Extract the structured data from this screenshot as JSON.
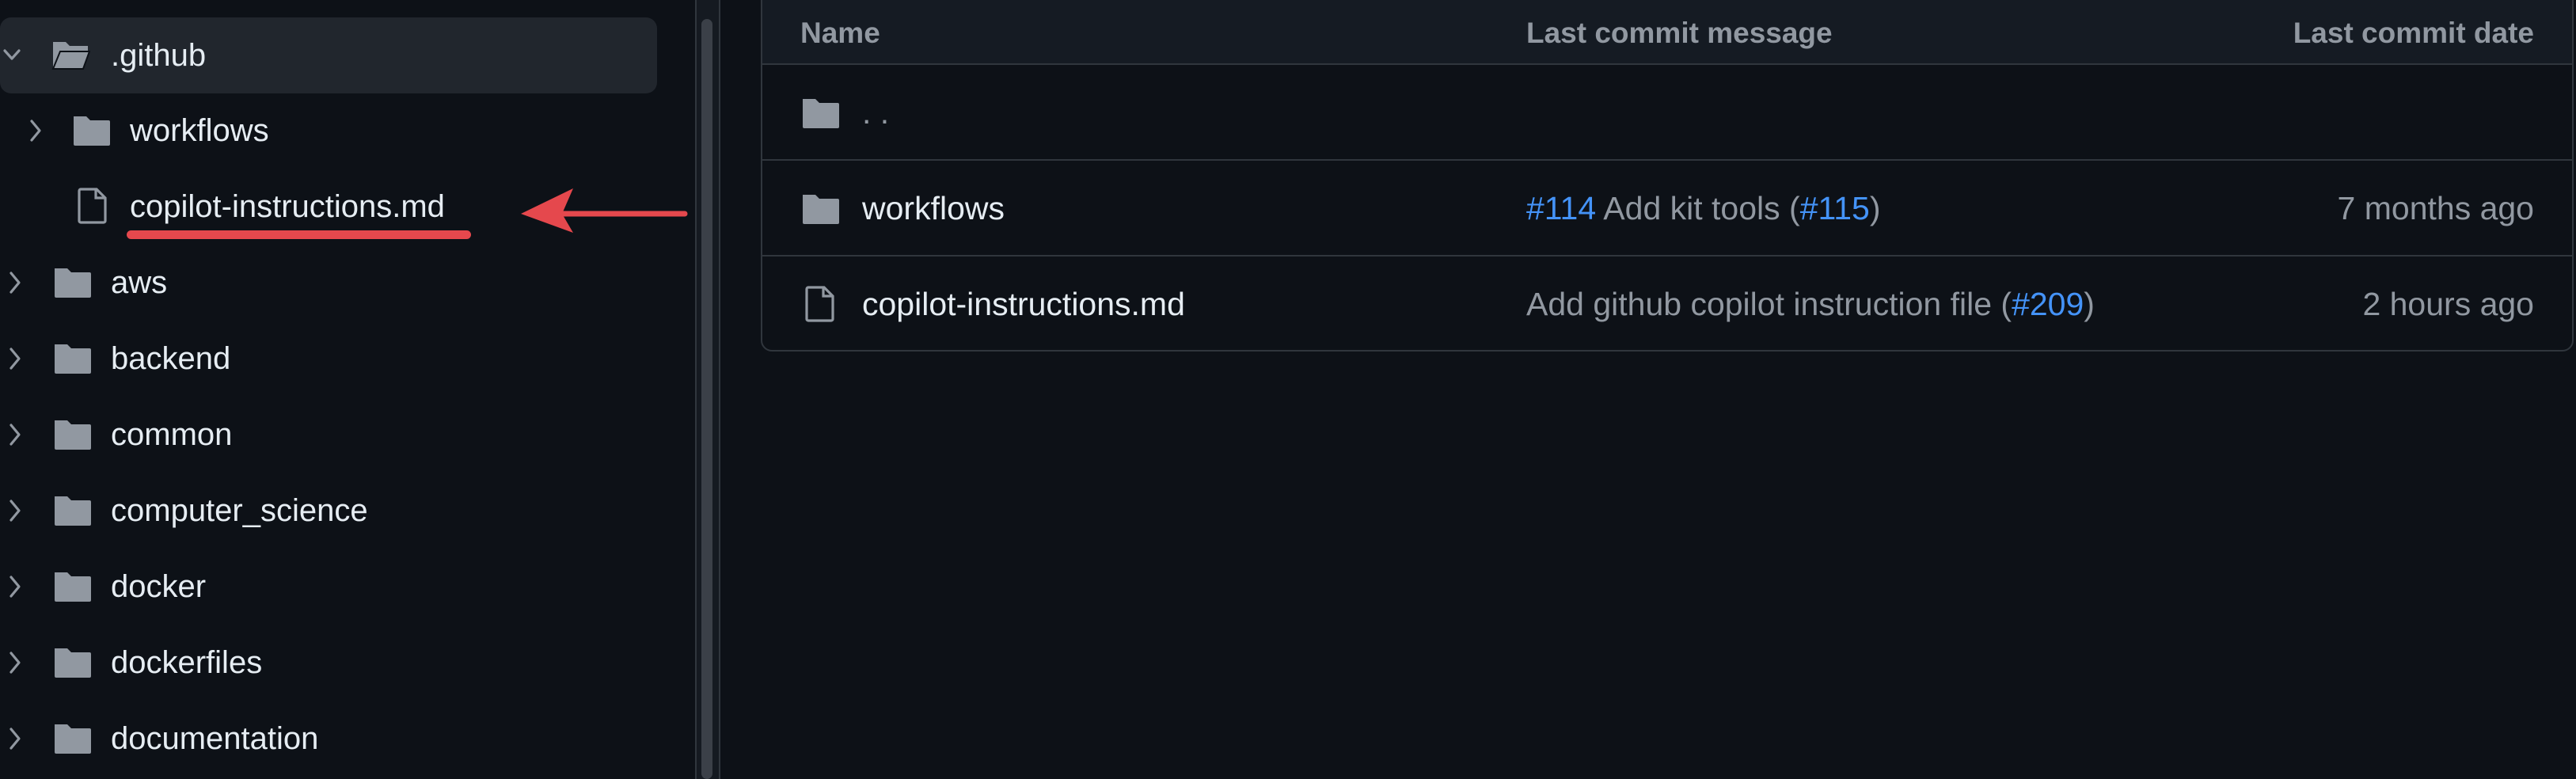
{
  "sidebar": {
    "items": [
      {
        "label": ".github",
        "type": "folder",
        "expanded": true,
        "selected": true
      },
      {
        "label": "workflows",
        "type": "folder",
        "expanded": false
      },
      {
        "label": "copilot-instructions.md",
        "type": "file",
        "highlighted": true
      },
      {
        "label": "aws",
        "type": "folder",
        "expanded": false
      },
      {
        "label": "backend",
        "type": "folder",
        "expanded": false
      },
      {
        "label": "common",
        "type": "folder",
        "expanded": false
      },
      {
        "label": "computer_science",
        "type": "folder",
        "expanded": false
      },
      {
        "label": "docker",
        "type": "folder",
        "expanded": false
      },
      {
        "label": "dockerfiles",
        "type": "folder",
        "expanded": false
      },
      {
        "label": "documentation",
        "type": "folder",
        "expanded": false
      }
    ]
  },
  "table": {
    "headers": {
      "name": "Name",
      "message": "Last commit message",
      "date": "Last commit date"
    },
    "parent": {
      "name": ". ."
    },
    "rows": [
      {
        "name": "workflows",
        "type": "folder",
        "message_parts": {
          "pr": "#114",
          "text": " Add kit tools (",
          "ref": "#115",
          "close": ")"
        },
        "date": "7 months ago"
      },
      {
        "name": "copilot-instructions.md",
        "type": "file",
        "message_parts": {
          "text": "Add github copilot instruction file (",
          "ref": "#209",
          "close": ")"
        },
        "date": "2 hours ago"
      }
    ]
  },
  "colors": {
    "background": "#0d1117",
    "link": "#4493f8",
    "annotation": "#e5484d",
    "muted_text": "#9198a1"
  }
}
